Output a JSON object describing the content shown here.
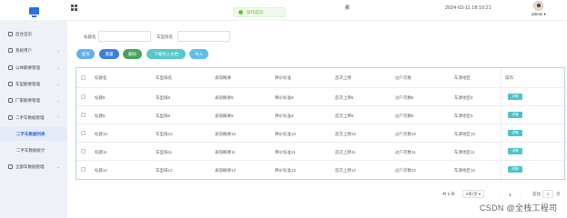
{
  "header": {
    "toast_text": "操作成功",
    "top_mark": "那",
    "datetime": "2024-03-11 18:10:21",
    "username": "admin ▾"
  },
  "sidebar": {
    "items": [
      {
        "label": "后台首页",
        "icon": "home-icon",
        "chevron": ""
      },
      {
        "label": "系统用户",
        "icon": "user-icon",
        "chevron": "⌄"
      },
      {
        "label": "公休额要管理",
        "icon": "doc-icon",
        "chevron": "⌄"
      },
      {
        "label": "车型额要管理",
        "icon": "doc-icon",
        "chevron": "⌄"
      },
      {
        "label": "厂家额要管理",
        "icon": "doc-icon",
        "chevron": "⌄"
      },
      {
        "label": "二手车数据管理",
        "icon": "doc-icon",
        "chevron": "⌃"
      },
      {
        "label": "二手车数据列表",
        "icon": "",
        "chevron": ""
      },
      {
        "label": "二手车数据统计",
        "icon": "",
        "chevron": ""
      },
      {
        "label": "全部车数据管理",
        "icon": "doc-icon",
        "chevron": "⌄"
      }
    ]
  },
  "search": {
    "label1": "标题名",
    "label2": "车型排名"
  },
  "toolbar": {
    "btn1": "查询",
    "btn2": "重置",
    "btn3": "删除",
    "btn4": "下载导入文档",
    "btn5": "导入"
  },
  "table": {
    "headers": [
      "标题名",
      "车型排名",
      "表现概要",
      "降价标准",
      "首次上牌",
      "过户次数",
      "车源地区",
      "操作"
    ],
    "rows": [
      [
        "标题8",
        "车型排8",
        "表现概要8",
        "降价标准8",
        "首次上牌8",
        "过户次数8",
        "车源地区8",
        "详情"
      ],
      [
        "标题9",
        "车型排9",
        "表现概要9",
        "降价标准9",
        "首次上牌9",
        "过户次数9",
        "车源地区9",
        "详情"
      ],
      [
        "标题10",
        "车型排10",
        "表现概要10",
        "降价标准10",
        "首次上牌10",
        "过户次数10",
        "车源地区10",
        "详情"
      ],
      [
        "标题11",
        "车型排11",
        "表现概要11",
        "降价标准11",
        "首次上牌11",
        "过户次数11",
        "车源地区11",
        "详情"
      ],
      [
        "标题12",
        "车型排12",
        "表现概要12",
        "降价标准12",
        "首次上牌12",
        "过户次数12",
        "车源地区12",
        "详情"
      ]
    ]
  },
  "pagination": {
    "total": "共 5 条",
    "page_size": "5条/页 ▾",
    "prev": "‹",
    "current": "1",
    "next": "›",
    "goto_label": "前往",
    "goto_value": "1",
    "goto_suffix": "页"
  },
  "watermark": "CSDN @全栈工程司",
  "colors": {
    "primary": "#2f6ee8",
    "query_btn": "#5fb0f0",
    "reset_btn": "#3a7fe0",
    "delete_btn": "#4aa35c",
    "download_btn": "#55c8c9",
    "import_btn": "#5cbfe8",
    "success": "#67c23a"
  }
}
